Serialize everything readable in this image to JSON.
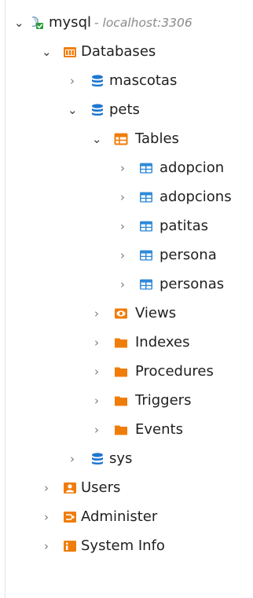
{
  "tree": {
    "connection": {
      "label": "mysql",
      "host": "- localhost:3306"
    },
    "databases_folder": {
      "label": "Databases"
    },
    "db_mascotas": {
      "label": "mascotas"
    },
    "db_pets": {
      "label": "pets"
    },
    "tables_folder": {
      "label": "Tables"
    },
    "tables": [
      {
        "label": "adopcion"
      },
      {
        "label": "adopcions"
      },
      {
        "label": "patitas"
      },
      {
        "label": "persona"
      },
      {
        "label": "personas"
      }
    ],
    "views_folder": {
      "label": "Views"
    },
    "indexes_folder": {
      "label": "Indexes"
    },
    "procedures_folder": {
      "label": "Procedures"
    },
    "triggers_folder": {
      "label": "Triggers"
    },
    "events_folder": {
      "label": "Events"
    },
    "db_sys": {
      "label": "sys"
    },
    "users_node": {
      "label": "Users"
    },
    "administer_node": {
      "label": "Administer"
    },
    "system_info_node": {
      "label": "System Info"
    }
  },
  "glyphs": {
    "expanded": "⌄",
    "collapsed": "›"
  },
  "colors": {
    "folder_orange": "#f07d0a",
    "database_blue": "#1f77d0",
    "table_blue": "#2f8ad8",
    "connected_green": "#2a9d3b"
  }
}
